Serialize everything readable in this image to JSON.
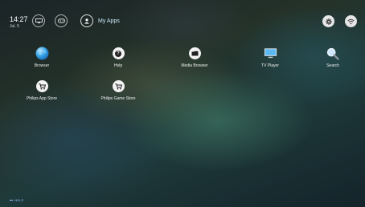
{
  "status": {
    "time": "14:27",
    "date": "Jul. 5"
  },
  "header": {
    "my_apps_label": "My Apps"
  },
  "apps": [
    {
      "label": "Browser",
      "icon": "globe-icon"
    },
    {
      "label": "Help",
      "icon": "help-icon"
    },
    {
      "label": "Media Browser",
      "icon": "media-icon"
    },
    {
      "label": "TV Player",
      "icon": "tv-icon"
    },
    {
      "label": "Search",
      "icon": "search-icon"
    },
    {
      "label": "Philips App Store",
      "icon": "cart-icon"
    },
    {
      "label": "Philips Game Store",
      "icon": "cart-icon"
    }
  ],
  "footer": {
    "hint": "HELP"
  },
  "colors": {
    "accent": "#cfe8ff",
    "hint": "#9ac0ff"
  }
}
